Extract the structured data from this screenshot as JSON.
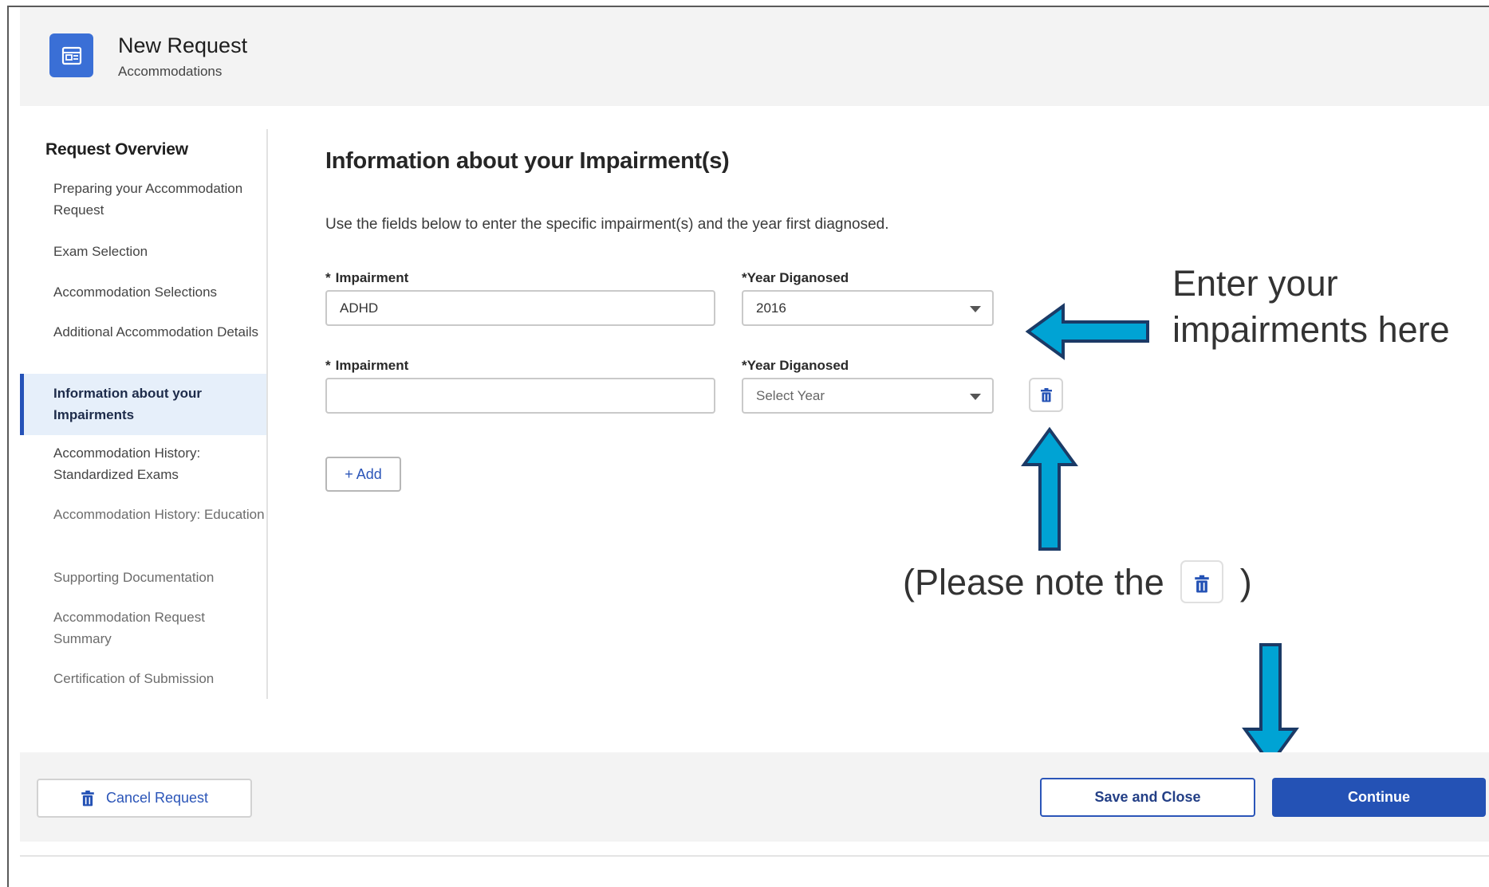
{
  "header": {
    "title": "New Request",
    "subtitle": "Accommodations",
    "icon": "calendar-icon"
  },
  "sidebar": {
    "title": "Request Overview",
    "items": [
      {
        "label": "Preparing your Accommodation Request",
        "state": "complete"
      },
      {
        "label": "Exam Selection",
        "state": "complete"
      },
      {
        "label": "Accommodation Selections",
        "state": "complete"
      },
      {
        "label": "Additional Accommodation Details",
        "state": "complete"
      },
      {
        "label": "Information about your Impairments",
        "state": "active"
      },
      {
        "label": "Accommodation History: Standardized Exams",
        "state": "complete"
      },
      {
        "label": "Accommodation History: Education",
        "state": "pending"
      },
      {
        "label": "Supporting Documentation",
        "state": "pending"
      },
      {
        "label": "Accommodation Request Summary",
        "state": "pending"
      },
      {
        "label": "Certification of Submission",
        "state": "pending"
      }
    ]
  },
  "main": {
    "title": "Information about your Impairment(s)",
    "description": "Use the fields below to enter the specific impairment(s) and the year first diagnosed.",
    "rows": [
      {
        "impairment_label": "Impairment",
        "impairment_value": "ADHD",
        "year_label": "Year Diganosed",
        "year_value": "2016"
      },
      {
        "impairment_label": "Impairment",
        "impairment_value": "",
        "year_label": "Year Diganosed",
        "year_value": "Select Year"
      }
    ],
    "required_marker": "*",
    "add_label": "+ Add"
  },
  "annotations": {
    "enter_text_line1": "Enter your",
    "enter_text_line2": "impairments here",
    "note_prefix": "(Please note the",
    "note_suffix": ")",
    "arrow_color": "#00a3d4"
  },
  "footer": {
    "cancel_label": "Cancel Request",
    "save_label": "Save and Close",
    "continue_label": "Continue"
  },
  "colors": {
    "primary": "#2452b5",
    "active_nav_bg": "#e6effa",
    "arrow_fill": "#00a3d4",
    "arrow_stroke": "#1b3a66"
  }
}
